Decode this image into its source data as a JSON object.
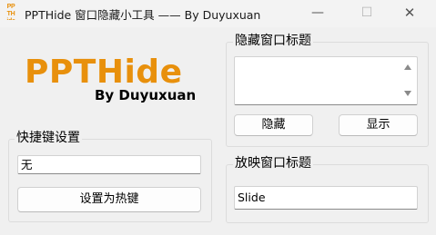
{
  "window": {
    "icon_text": "PPTHide",
    "title": "PPTHide 窗口隐藏小工具 —— By Duyuxuan",
    "min_symbol": "—",
    "max_symbol": "☐",
    "close_symbol": "✕"
  },
  "logo": {
    "name": "PPTHide",
    "author": "By Duyuxuan",
    "color": "#e8900c"
  },
  "hotkey_group": {
    "label": "快捷键设置",
    "current_value": "无",
    "set_button": "设置为热键"
  },
  "hide_group": {
    "label": "隐藏窗口标题",
    "textarea_value": "",
    "hide_button": "隐藏",
    "show_button": "显示"
  },
  "show_group": {
    "label": "放映窗口标题",
    "value": "Slide"
  }
}
